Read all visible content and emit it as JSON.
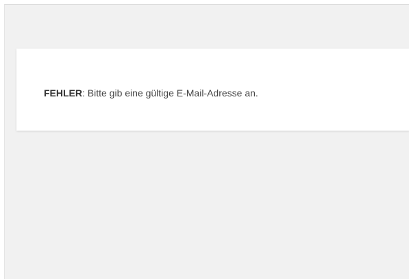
{
  "error": {
    "label": "FEHLER",
    "separator": ":",
    "message": " Bitte gib eine gültige E-Mail-Adresse an."
  },
  "colors": {
    "background": "#f1f1f1",
    "box": "#ffffff",
    "text": "#444444"
  }
}
